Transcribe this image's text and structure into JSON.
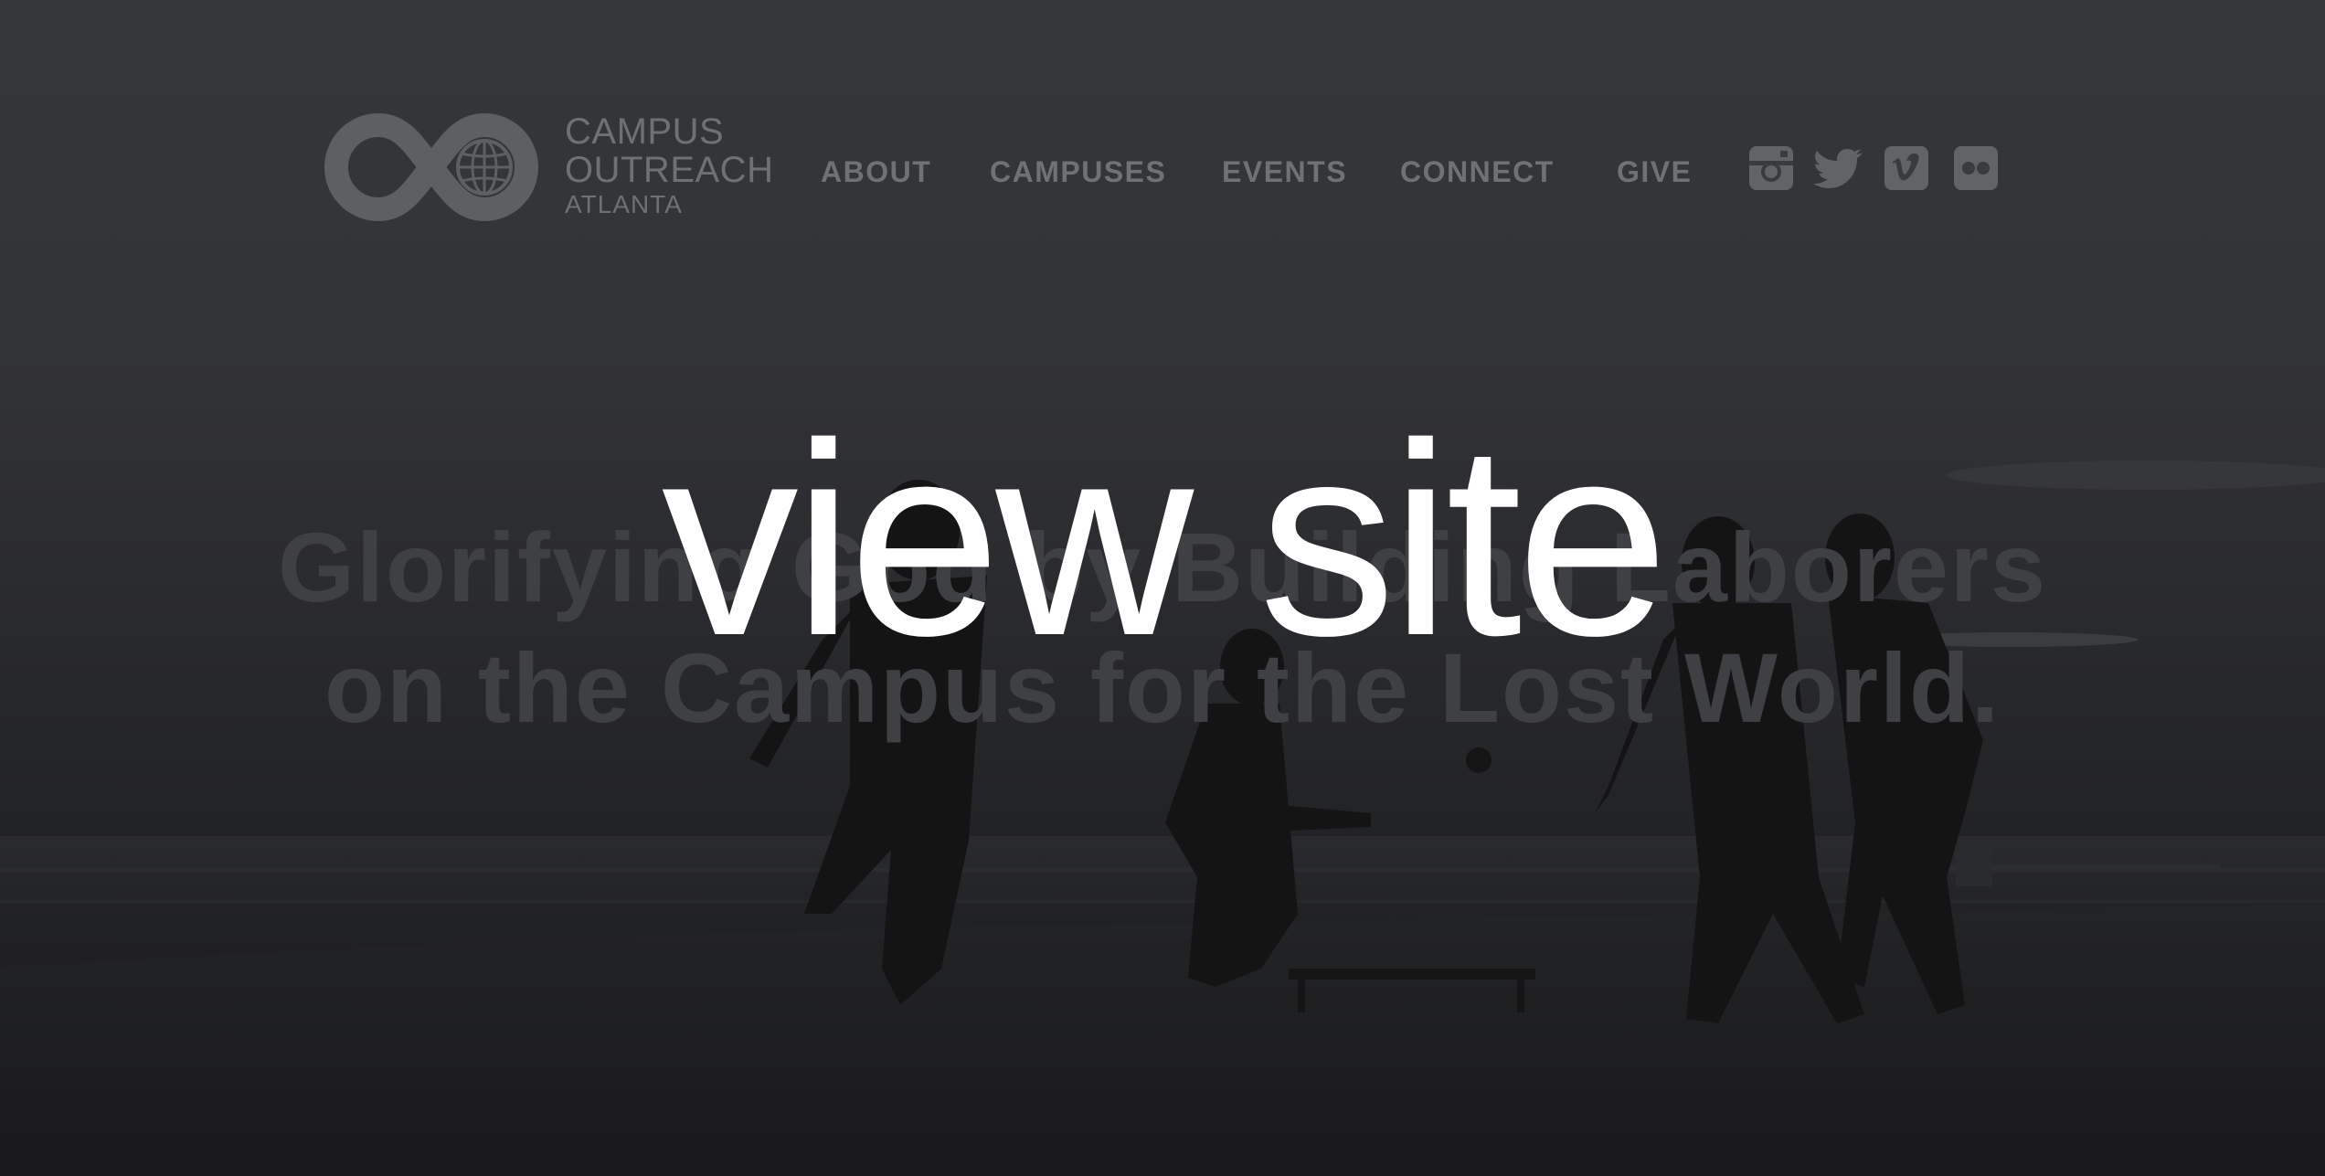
{
  "logo": {
    "line1": "CAMPUS",
    "line2": "OUTREACH",
    "line3": "ATLANTA",
    "icon": "infinity-globe-logo"
  },
  "nav": {
    "items": [
      {
        "label": "ABOUT"
      },
      {
        "label": "CAMPUSES"
      },
      {
        "label": "EVENTS"
      },
      {
        "label": "CONNECT"
      },
      {
        "label": "GIVE"
      }
    ]
  },
  "social": {
    "icons": [
      "instagram-icon",
      "twitter-icon",
      "vimeo-icon",
      "flickr-icon"
    ]
  },
  "hero": {
    "tagline_line1": "Glorifying God by Building Laborers",
    "tagline_line2": "on the Campus for the Lost World."
  },
  "overlay": {
    "label": "view site"
  },
  "colors": {
    "overlay_text": "#ffffff",
    "header_text": "#707174",
    "background": "#2b2c2f"
  }
}
